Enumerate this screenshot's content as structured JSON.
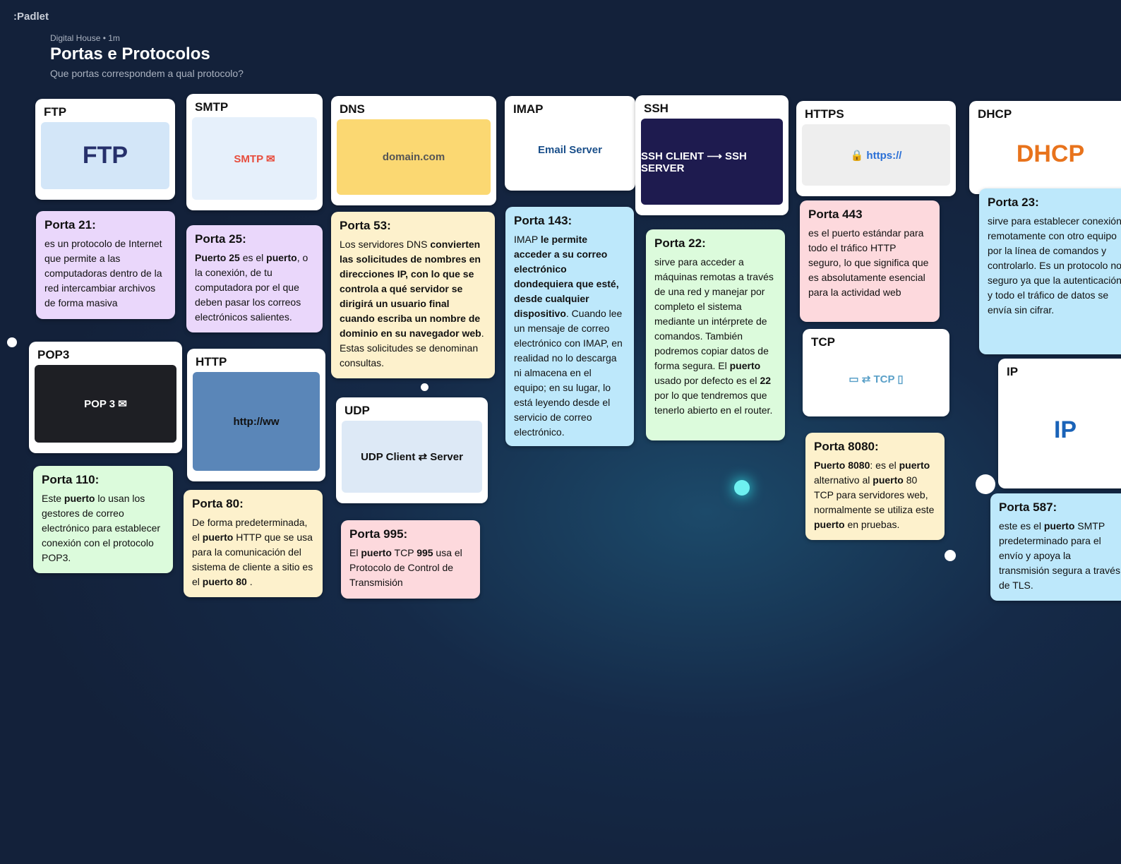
{
  "app": {
    "logo": ":Padlet",
    "meta": "Digital House • 1m",
    "title": "Portas e Protocolos",
    "subtitle": "Que portas correspondem a qual protocolo?"
  },
  "image_cards": [
    {
      "title": "FTP",
      "img_text": "FTP",
      "img_bg": "#d3e6f8",
      "img_color": "#26306b"
    },
    {
      "title": "POP3",
      "img_text": "POP 3 ✉",
      "img_bg": "#1e1f24",
      "img_color": "#ffffff"
    },
    {
      "title": "SMTP",
      "img_text": "SMTP ✉",
      "img_bg": "#e6f0fb",
      "img_color": "#e74c3c"
    },
    {
      "title": "HTTP",
      "img_text": "http://ww",
      "img_bg": "#5a86b8",
      "img_color": "#111111"
    },
    {
      "title": "DNS",
      "img_text": "domain.com",
      "img_bg": "#fbd872",
      "img_color": "#555555"
    },
    {
      "title": "UDP",
      "img_text": "UDP  Client ⇄ Server",
      "img_bg": "#dde9f6",
      "img_color": "#111111"
    },
    {
      "title": "IMAP",
      "img_text": "Email Server",
      "img_bg": "#ffffff",
      "img_color": "#1a4f8a"
    },
    {
      "title": "SSH",
      "img_text": "SSH CLIENT ⟶ SSH SERVER",
      "img_bg": "#1e1b4f",
      "img_color": "#ffffff"
    },
    {
      "title": "HTTPS",
      "img_text": "🔒 https://",
      "img_bg": "#eeeeee",
      "img_color": "#2a6fd6"
    },
    {
      "title": "TCP",
      "img_text": "▭  ⇄ TCP  ▯",
      "img_bg": "#ffffff",
      "img_color": "#5aa0c8"
    },
    {
      "title": "DHCP",
      "img_text": "DHCP",
      "img_bg": "#ffffff",
      "img_color": "#e8731c"
    },
    {
      "title": "IP",
      "img_text": "IP",
      "img_bg": "#ffffff",
      "img_color": "#1a63b8"
    }
  ],
  "notes": [
    {
      "title": "Porta 21:",
      "color": "purple",
      "body": [
        {
          "t": "es un protocolo de Internet que permite a las computadoras dentro de la red intercambiar archivos de forma masiva"
        }
      ]
    },
    {
      "title": "Porta 110:",
      "color": "green",
      "body": [
        {
          "t": " Este "
        },
        {
          "t": "puerto",
          "b": 1
        },
        {
          "t": " lo usan los gestores de correo electrónico para establecer conexión con el protocolo POP3."
        }
      ]
    },
    {
      "title": "Porta 25:",
      "color": "purple",
      "body": [
        {
          "t": "Puerto 25",
          "b": 1
        },
        {
          "t": " es el "
        },
        {
          "t": "puerto",
          "b": 1
        },
        {
          "t": ", o la conexión, de tu computadora por el que deben pasar los correos electrónicos salientes."
        }
      ]
    },
    {
      "title": "Porta 80:",
      "color": "yellow",
      "body": [
        {
          "t": "De forma predeterminada, el "
        },
        {
          "t": "puerto",
          "b": 1
        },
        {
          "t": " HTTP que se usa para la comunicación del sistema de cliente a sitio es el "
        },
        {
          "t": "puerto 80",
          "b": 1
        },
        {
          "t": " ."
        }
      ]
    },
    {
      "title": "Porta 53:",
      "color": "yellow",
      "body": [
        {
          "t": "Los servidores DNS "
        },
        {
          "t": "convierten las solicitudes de nombres en direcciones IP, con lo que se controla a qué servidor se dirigirá un usuario final cuando escriba un nombre de dominio en su navegador web",
          "b": 1
        },
        {
          "t": ". Estas solicitudes se denominan consultas."
        }
      ]
    },
    {
      "title": "Porta 995:",
      "color": "pink",
      "body": [
        {
          "t": "El "
        },
        {
          "t": "puerto",
          "b": 1
        },
        {
          "t": " TCP "
        },
        {
          "t": "995",
          "b": 1
        },
        {
          "t": " usa el Protocolo de Control de Transmisión"
        }
      ]
    },
    {
      "title": "Porta 143:",
      "color": "blue",
      "body": [
        {
          "t": "IMAP "
        },
        {
          "t": "le permite acceder a su correo electrónico dondequiera que esté, desde cualquier dispositivo",
          "b": 1
        },
        {
          "t": ". Cuando lee un mensaje de correo electrónico con IMAP, en realidad no lo descarga ni almacena en el equipo; en su lugar, lo está leyendo desde el servicio de correo electrónico."
        }
      ]
    },
    {
      "title": "Porta 22:",
      "color": "green",
      "body": [
        {
          "t": "sirve para acceder a máquinas remotas a través de una red y manejar por completo el sistema mediante un intérprete de comandos. También podremos copiar datos de forma segura. El "
        },
        {
          "t": "puerto",
          "b": 1
        },
        {
          "t": " usado por defecto es el "
        },
        {
          "t": "22",
          "b": 1
        },
        {
          "t": " por lo que tendremos que tenerlo abierto en el router."
        }
      ]
    },
    {
      "title": "Porta 443",
      "color": "pink",
      "body": [
        {
          "t": "es el puerto estándar para todo el tráfico HTTP seguro, lo que significa que es absolutamente esencial para la actividad web"
        }
      ]
    },
    {
      "title": "Porta 8080:",
      "color": "yellow",
      "body": [
        {
          "t": "Puerto 8080",
          "b": 1
        },
        {
          "t": ": es el "
        },
        {
          "t": "puerto",
          "b": 1
        },
        {
          "t": " alternativo al "
        },
        {
          "t": "puerto",
          "b": 1
        },
        {
          "t": " 80 TCP para servidores web, normalmente se utiliza este "
        },
        {
          "t": "puerto",
          "b": 1
        },
        {
          "t": " en pruebas."
        }
      ]
    },
    {
      "title": "Porta 23:",
      "color": "blue",
      "body": [
        {
          "t": "sirve para establecer conexión remotamente con otro equipo por la línea de comandos y controlarlo. Es un protocolo no seguro ya que la autenticación y todo el tráfico de datos se envía sin cifrar."
        }
      ]
    },
    {
      "title": "Porta 587:",
      "color": "blue",
      "body": [
        {
          "t": " este es el "
        },
        {
          "t": "puerto",
          "b": 1
        },
        {
          "t": " SMTP predeterminado para el envío y apoya la transmisión segura a través de TLS."
        }
      ]
    }
  ]
}
